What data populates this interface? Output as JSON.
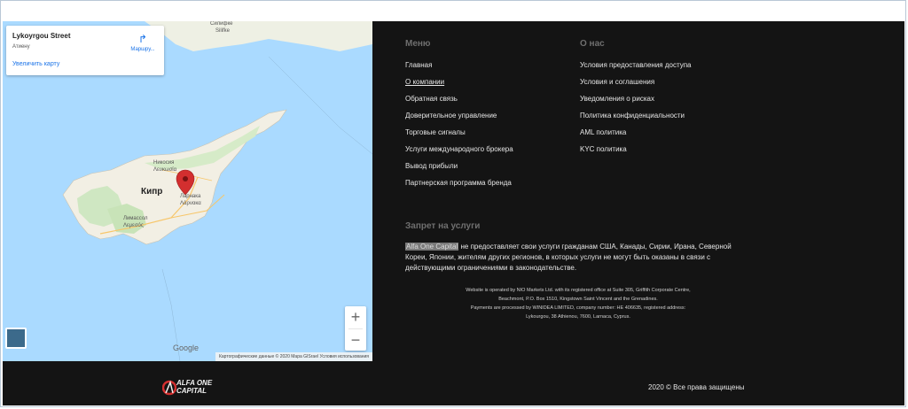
{
  "map": {
    "card_title": "Lykoyrgou Street",
    "card_subtitle": "Атиену",
    "card_link": "Увеличить карту",
    "route_label": "Маршру...",
    "country_label": "Кипр",
    "top_city": "Силифке",
    "top_city_alt": "Silifke",
    "nicosia": "Никосия",
    "nicosia_alt": "Λευκωσία",
    "limassol": "Лимассол",
    "limassol_alt": "Λεμεσός",
    "larnaca": "Ларнака",
    "larnaca_alt": "Λάρνακα",
    "google": "Google",
    "attribution": "Картографические данные © 2020 Mapa GISrael   Условия использования",
    "zoom_in": "+",
    "zoom_out": "−"
  },
  "menu": {
    "title": "Меню",
    "items": [
      "Главная",
      "О компании",
      "Обратная связь",
      "Доверительное управление",
      "Торговые сигналы",
      "Услуги международного брокера",
      "Вывод прибыли",
      "Партнерская программа бренда"
    ]
  },
  "about": {
    "title": "О нас",
    "items": [
      "Условия предоставления доступа",
      "Условия и соглашения",
      "Уведомления о рисках",
      "Политика конфиденциальности",
      "AML политика",
      "KYC политика"
    ]
  },
  "ban": {
    "title": "Запрет на услуги",
    "company": "Alfa One Capital",
    "text": " не предоставляет свои услуги гражданам США, Канады, Сирии, Ирана, Северной Кореи, Японии, жителям других регионов, в которых услуги не могут быть оказаны в связи с действующими ограничениями в законодательстве."
  },
  "legal": {
    "line1": "Website is operated by NIO Markets Ltd. with its registered office at Suite 305, Griffith Corporate Centre,",
    "line2": "Beachmont, P.O. Box 1510, Kingstown Saint Vincent and the Grenadines.",
    "line3": "Payments are processed by WINIDEA LIMITED, company number: HE 406635, registered address:",
    "line4": "Lykourgou, 38 Athienou, 7600, Larnaca, Cyprus."
  },
  "footer": {
    "logo_line1": "ALFA ONE",
    "logo_line2": "CAPITAL",
    "copyright": "2020 © Все права защищены"
  },
  "colors": {
    "background": "#141414",
    "water": "#aadaff",
    "land": "#f4f1ea",
    "accent": "#d32f2f",
    "link": "#1a73e8"
  }
}
